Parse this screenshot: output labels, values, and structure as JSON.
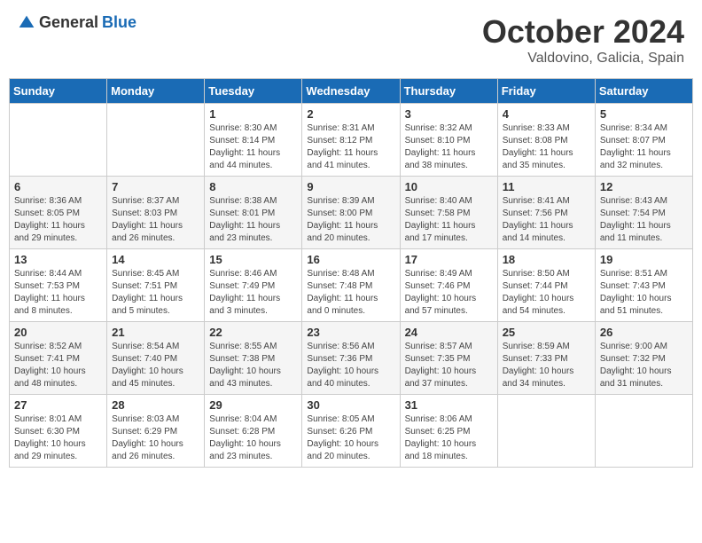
{
  "header": {
    "logo_general": "General",
    "logo_blue": "Blue",
    "title": "October 2024",
    "location": "Valdovino, Galicia, Spain"
  },
  "weekdays": [
    "Sunday",
    "Monday",
    "Tuesday",
    "Wednesday",
    "Thursday",
    "Friday",
    "Saturday"
  ],
  "weeks": [
    [
      {
        "day": "",
        "info": ""
      },
      {
        "day": "",
        "info": ""
      },
      {
        "day": "1",
        "info": "Sunrise: 8:30 AM\nSunset: 8:14 PM\nDaylight: 11 hours and 44 minutes."
      },
      {
        "day": "2",
        "info": "Sunrise: 8:31 AM\nSunset: 8:12 PM\nDaylight: 11 hours and 41 minutes."
      },
      {
        "day": "3",
        "info": "Sunrise: 8:32 AM\nSunset: 8:10 PM\nDaylight: 11 hours and 38 minutes."
      },
      {
        "day": "4",
        "info": "Sunrise: 8:33 AM\nSunset: 8:08 PM\nDaylight: 11 hours and 35 minutes."
      },
      {
        "day": "5",
        "info": "Sunrise: 8:34 AM\nSunset: 8:07 PM\nDaylight: 11 hours and 32 minutes."
      }
    ],
    [
      {
        "day": "6",
        "info": "Sunrise: 8:36 AM\nSunset: 8:05 PM\nDaylight: 11 hours and 29 minutes."
      },
      {
        "day": "7",
        "info": "Sunrise: 8:37 AM\nSunset: 8:03 PM\nDaylight: 11 hours and 26 minutes."
      },
      {
        "day": "8",
        "info": "Sunrise: 8:38 AM\nSunset: 8:01 PM\nDaylight: 11 hours and 23 minutes."
      },
      {
        "day": "9",
        "info": "Sunrise: 8:39 AM\nSunset: 8:00 PM\nDaylight: 11 hours and 20 minutes."
      },
      {
        "day": "10",
        "info": "Sunrise: 8:40 AM\nSunset: 7:58 PM\nDaylight: 11 hours and 17 minutes."
      },
      {
        "day": "11",
        "info": "Sunrise: 8:41 AM\nSunset: 7:56 PM\nDaylight: 11 hours and 14 minutes."
      },
      {
        "day": "12",
        "info": "Sunrise: 8:43 AM\nSunset: 7:54 PM\nDaylight: 11 hours and 11 minutes."
      }
    ],
    [
      {
        "day": "13",
        "info": "Sunrise: 8:44 AM\nSunset: 7:53 PM\nDaylight: 11 hours and 8 minutes."
      },
      {
        "day": "14",
        "info": "Sunrise: 8:45 AM\nSunset: 7:51 PM\nDaylight: 11 hours and 5 minutes."
      },
      {
        "day": "15",
        "info": "Sunrise: 8:46 AM\nSunset: 7:49 PM\nDaylight: 11 hours and 3 minutes."
      },
      {
        "day": "16",
        "info": "Sunrise: 8:48 AM\nSunset: 7:48 PM\nDaylight: 11 hours and 0 minutes."
      },
      {
        "day": "17",
        "info": "Sunrise: 8:49 AM\nSunset: 7:46 PM\nDaylight: 10 hours and 57 minutes."
      },
      {
        "day": "18",
        "info": "Sunrise: 8:50 AM\nSunset: 7:44 PM\nDaylight: 10 hours and 54 minutes."
      },
      {
        "day": "19",
        "info": "Sunrise: 8:51 AM\nSunset: 7:43 PM\nDaylight: 10 hours and 51 minutes."
      }
    ],
    [
      {
        "day": "20",
        "info": "Sunrise: 8:52 AM\nSunset: 7:41 PM\nDaylight: 10 hours and 48 minutes."
      },
      {
        "day": "21",
        "info": "Sunrise: 8:54 AM\nSunset: 7:40 PM\nDaylight: 10 hours and 45 minutes."
      },
      {
        "day": "22",
        "info": "Sunrise: 8:55 AM\nSunset: 7:38 PM\nDaylight: 10 hours and 43 minutes."
      },
      {
        "day": "23",
        "info": "Sunrise: 8:56 AM\nSunset: 7:36 PM\nDaylight: 10 hours and 40 minutes."
      },
      {
        "day": "24",
        "info": "Sunrise: 8:57 AM\nSunset: 7:35 PM\nDaylight: 10 hours and 37 minutes."
      },
      {
        "day": "25",
        "info": "Sunrise: 8:59 AM\nSunset: 7:33 PM\nDaylight: 10 hours and 34 minutes."
      },
      {
        "day": "26",
        "info": "Sunrise: 9:00 AM\nSunset: 7:32 PM\nDaylight: 10 hours and 31 minutes."
      }
    ],
    [
      {
        "day": "27",
        "info": "Sunrise: 8:01 AM\nSunset: 6:30 PM\nDaylight: 10 hours and 29 minutes."
      },
      {
        "day": "28",
        "info": "Sunrise: 8:03 AM\nSunset: 6:29 PM\nDaylight: 10 hours and 26 minutes."
      },
      {
        "day": "29",
        "info": "Sunrise: 8:04 AM\nSunset: 6:28 PM\nDaylight: 10 hours and 23 minutes."
      },
      {
        "day": "30",
        "info": "Sunrise: 8:05 AM\nSunset: 6:26 PM\nDaylight: 10 hours and 20 minutes."
      },
      {
        "day": "31",
        "info": "Sunrise: 8:06 AM\nSunset: 6:25 PM\nDaylight: 10 hours and 18 minutes."
      },
      {
        "day": "",
        "info": ""
      },
      {
        "day": "",
        "info": ""
      }
    ]
  ]
}
